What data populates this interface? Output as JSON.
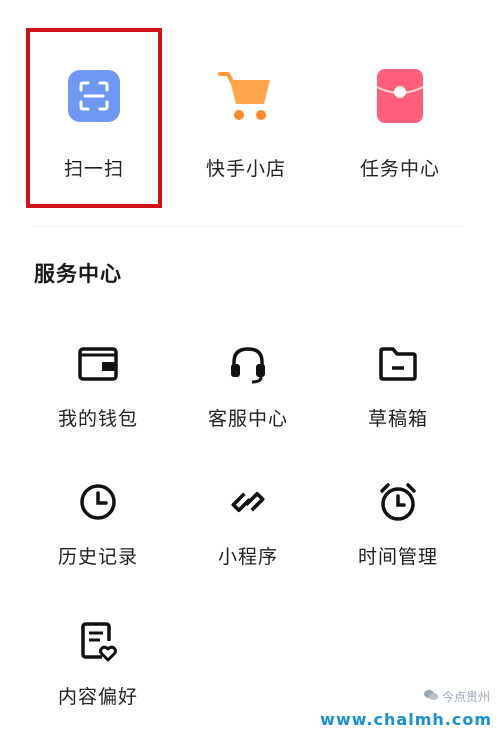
{
  "top_actions": [
    {
      "label": "扫一扫",
      "icon": "scan-icon",
      "color": "#6f98f4"
    },
    {
      "label": "快手小店",
      "icon": "cart-icon",
      "color": "#ff9a3c"
    },
    {
      "label": "任务中心",
      "icon": "red-envelope-icon",
      "color": "#ff5f7a"
    }
  ],
  "highlight_color": "#d0121b",
  "service_center": {
    "title": "服务中心",
    "items": [
      {
        "label": "我的钱包",
        "icon": "wallet-icon"
      },
      {
        "label": "客服中心",
        "icon": "headset-icon"
      },
      {
        "label": "草稿箱",
        "icon": "folder-icon"
      },
      {
        "label": "历史记录",
        "icon": "clock-icon"
      },
      {
        "label": "小程序",
        "icon": "mini-program-icon"
      },
      {
        "label": "时间管理",
        "icon": "alarm-clock-icon"
      },
      {
        "label": "内容偏好",
        "icon": "document-heart-icon"
      }
    ]
  },
  "watermark": {
    "text": "今点贵州",
    "url": "www.chalmh.com"
  }
}
